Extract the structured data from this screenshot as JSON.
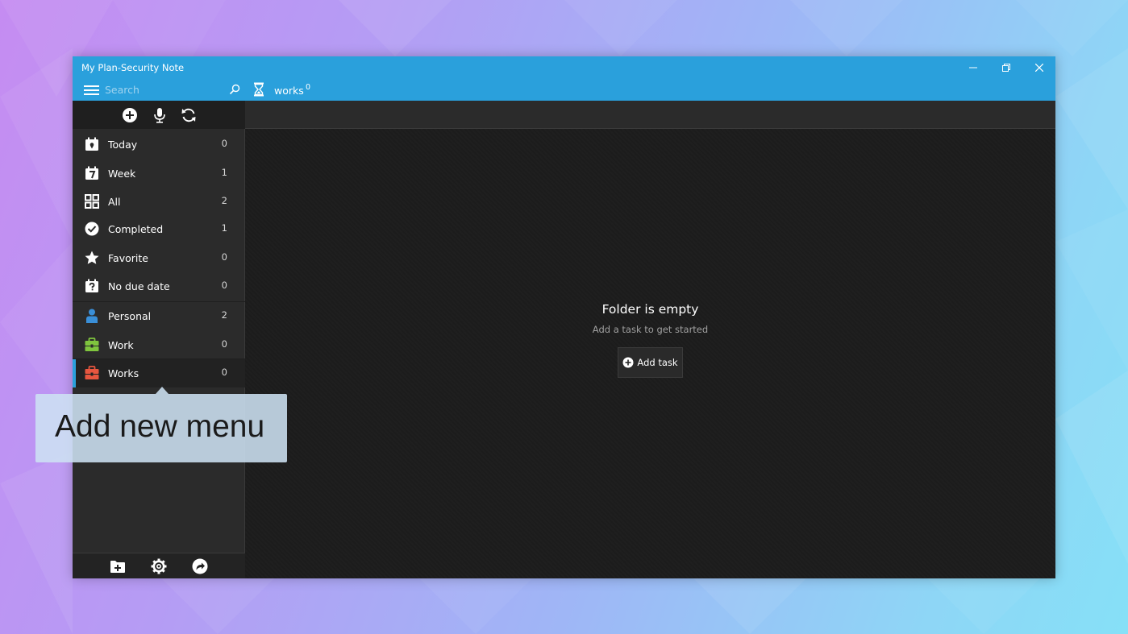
{
  "window": {
    "title": "My Plan-Security Note"
  },
  "appbar": {
    "search_placeholder": "Search",
    "current_folder": "works",
    "current_folder_count": "0"
  },
  "sidebar": {
    "smart_lists": [
      {
        "label": "Today",
        "count": "0",
        "icon": "calendar-today-icon"
      },
      {
        "label": "Week",
        "count": "1",
        "icon": "calendar-week-icon"
      },
      {
        "label": "All",
        "count": "2",
        "icon": "grid-icon"
      },
      {
        "label": "Completed",
        "count": "1",
        "icon": "check-circle-icon"
      },
      {
        "label": "Favorite",
        "count": "0",
        "icon": "star-icon"
      },
      {
        "label": "No due date",
        "count": "0",
        "icon": "calendar-question-icon"
      }
    ],
    "folders": [
      {
        "label": "Personal",
        "count": "2",
        "icon": "person-icon",
        "color": "#3a8fd8"
      },
      {
        "label": "Work",
        "count": "0",
        "icon": "briefcase-icon",
        "color": "#7fc53e"
      },
      {
        "label": "Works",
        "count": "0",
        "icon": "briefcase-icon",
        "color": "#e8563f"
      }
    ]
  },
  "main": {
    "empty_title": "Folder is empty",
    "empty_subtitle": "Add a task to get started",
    "add_task_label": "Add task"
  },
  "tooltip": {
    "text": "Add new menu"
  },
  "colors": {
    "accent": "#2aa0dc",
    "sidebar_bg": "#2b2b2b",
    "main_bg": "#1c1c1c"
  }
}
